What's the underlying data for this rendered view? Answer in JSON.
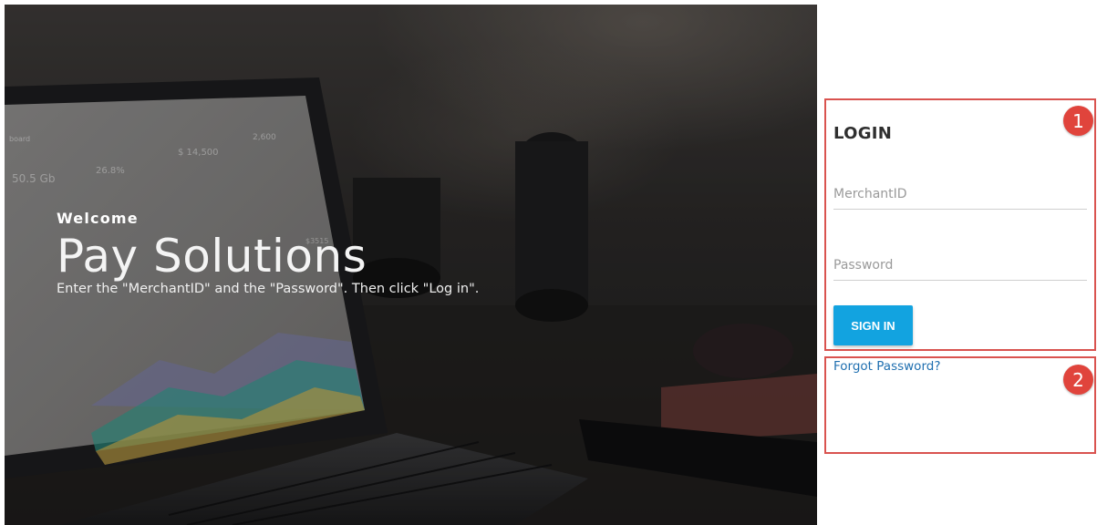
{
  "hero": {
    "welcome": "Welcome",
    "brand": "Pay Solutions",
    "instructions": "Enter the \"MerchantID\" and the \"Password\". Then click \"Log in\"."
  },
  "login": {
    "title": "LOGIN",
    "merchant_placeholder": "MerchantID",
    "password_placeholder": "Password",
    "signin_label": "SIGN IN",
    "forgot_label": "Forgot Password?"
  },
  "markers": {
    "login_box": "1",
    "forgot_box": "2"
  },
  "colors": {
    "accent": "#12a3e0",
    "marker": "#e0443c",
    "link": "#1f6fb0"
  },
  "laptop_screen": {
    "labels": [
      "board",
      "50.5 Gb",
      "26.8%",
      "$ 14,500",
      "2,600",
      "$3515"
    ]
  }
}
